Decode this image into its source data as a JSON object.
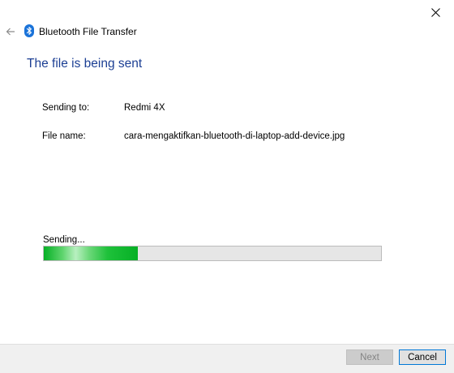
{
  "window": {
    "title": "Bluetooth File Transfer",
    "icons": {
      "back": "back-arrow-icon",
      "app": "bluetooth-icon",
      "close": "close-icon"
    }
  },
  "main": {
    "heading": "The file is being sent",
    "sending_to_label": "Sending to:",
    "sending_to_value": "Redmi 4X",
    "file_name_label": "File name:",
    "file_name_value": "cara-mengaktifkan-bluetooth-di-laptop-add-device.jpg",
    "status_text": "Sending...",
    "progress_fraction": 0.28
  },
  "footer": {
    "next_label": "Next",
    "cancel_label": "Cancel"
  },
  "colors": {
    "heading": "#1c3f94",
    "progress_fill": "#06b025",
    "cancel_border": "#0078d7"
  }
}
